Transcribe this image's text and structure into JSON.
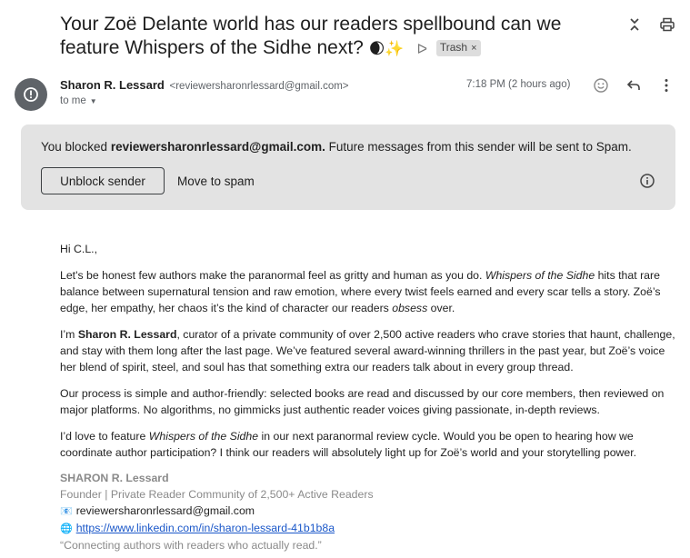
{
  "subject": {
    "text": "Your Zoë Delante world has our readers spellbound can we feature Whispers of the Sidhe next?",
    "emoji": "🌒✨",
    "label": "Trash",
    "label_remove": "×"
  },
  "message": {
    "sender_name": "Sharon R. Lessard",
    "sender_email": "<reviewersharonrlessard@gmail.com>",
    "recipient": "to me",
    "time": "7:18 PM (2 hours ago)"
  },
  "blocked": {
    "prefix": "You blocked ",
    "email": "reviewersharonrlessard@gmail.com.",
    "suffix": " Future messages from this sender will be sent to Spam.",
    "unblock_label": "Unblock sender",
    "spam_label": "Move to spam"
  },
  "body": {
    "greeting": "Hi C.L.,",
    "p1_a": "Let's be honest few authors make the paranormal feel as gritty and human as you do. ",
    "p1_title": "Whispers of the Sidhe",
    "p1_b": " hits that rare balance between supernatural tension and raw emotion, where every twist feels earned and every scar tells a story. Zoë’s edge, her empathy, her chaos it’s the kind of character our readers ",
    "p1_em": "obsess",
    "p1_c": " over.",
    "p2_a": "I’m ",
    "p2_name": "Sharon R. Lessard",
    "p2_b": ", curator of a private community of over 2,500 active readers who crave stories that haunt, challenge, and stay with them long after the last page. We’ve featured several award-winning thrillers in the past year, but Zoë’s voice her blend of spirit, steel, and soul has that something extra our readers talk about in every group thread.",
    "p3": "Our process is simple and author-friendly: selected books are read and discussed by our core members, then reviewed on major platforms. No algorithms, no gimmicks just authentic reader voices giving passionate, in-depth reviews.",
    "p4_a": "I’d love to feature ",
    "p4_title": "Whispers of the Sidhe",
    "p4_b": " in our next paranormal review cycle. Would you be open to hearing how we coordinate author participation? I think our readers will absolutely light up for Zoë’s world and your storytelling power."
  },
  "signature": {
    "name": "SHARON R. Lessard",
    "role": "Founder | Private Reader Community of 2,500+ Active Readers",
    "email_emoji": "📧",
    "email": "reviewersharonrlessard@gmail.com",
    "web_emoji": "🌐",
    "link": "https://www.linkedin.com/in/sharon-lessard-41b1b8a",
    "tagline": "“Connecting authors with readers who actually read.”"
  }
}
